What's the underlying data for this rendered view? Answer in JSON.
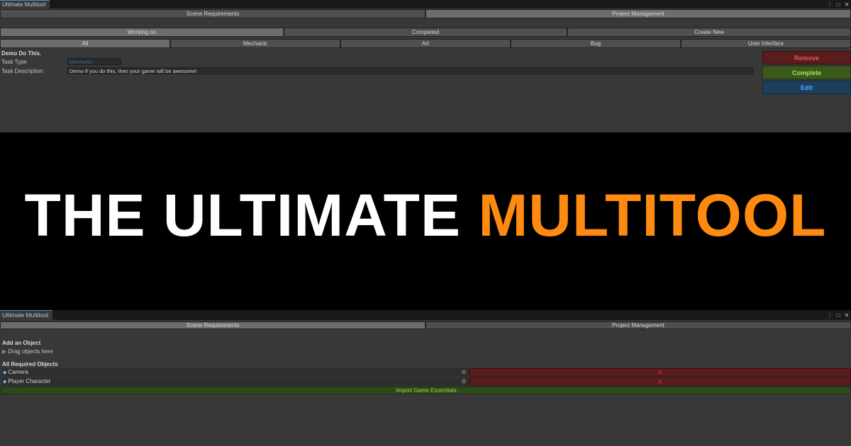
{
  "window_title": "Ultimate Multitool",
  "window_controls": [
    "⋮",
    "□",
    "✕"
  ],
  "top_panel": {
    "main_tabs": [
      "Scene Requirements",
      "Project Management"
    ],
    "status_tabs": [
      "Working on",
      "Completed",
      "Create New"
    ],
    "filter_tabs": [
      "All",
      "Mechanic",
      "Art",
      "Bug",
      "User Interface"
    ],
    "task": {
      "title": "Demo Do This.",
      "type_label": "Task Type",
      "type_value": "Mechanic",
      "description_label": "Task Description",
      "description_value": "Demo if you do this, then your game will be awesome!"
    },
    "buttons": {
      "remove": "Remove",
      "complete": "Complete",
      "edit": "Edit"
    },
    "colors": {
      "remove_bg": "#5a1c1c",
      "remove_text": "#e35a5a",
      "complete_bg": "#3a5a1c",
      "complete_text": "#a6e35a",
      "edit_bg": "#1c3f5e",
      "edit_text": "#4aa8ff"
    }
  },
  "banner": {
    "title_white": "THE ULTIMATE ",
    "title_orange": "MULTITOOL",
    "accent_color": "#ff8a12"
  },
  "bottom_panel": {
    "main_tabs": [
      "Scene Requirements",
      "Project Management"
    ],
    "add_object_heading": "Add an Object",
    "drag_hint": "Drag objects here",
    "required_heading": "All Required Objects",
    "objects": [
      {
        "name": "Camera",
        "remove": "X"
      },
      {
        "name": "Player Character",
        "remove": "X"
      }
    ],
    "import_button": "Import Game Essentials"
  }
}
